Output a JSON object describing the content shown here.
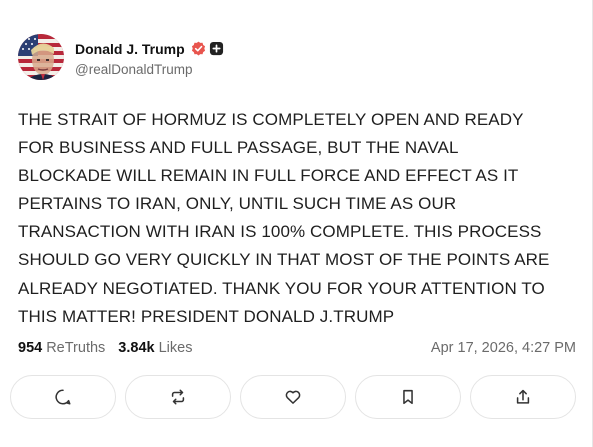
{
  "colors": {
    "verified_badge": "#e8554e",
    "follow_badge": "#222222",
    "muted_text": "#6b6b6b",
    "button_border": "#e4e4e4"
  },
  "author": {
    "display_name": "Donald J. Trump",
    "handle": "@realDonaldTrump",
    "avatar": "avatar-american-flag-portrait",
    "verified_icon": "verified-badge-icon",
    "follow_icon": "follow-plus-icon"
  },
  "post": {
    "lines": [
      "THE STRAIT OF HORMUZ IS COMPLETELY OPEN AND READY",
      "FOR BUSINESS AND FULL PASSAGE, BUT THE NAVAL",
      "BLOCKADE WILL REMAIN IN FULL FORCE AND EFFECT AS IT",
      "PERTAINS TO IRAN, ONLY, UNTIL SUCH TIME AS OUR",
      "TRANSACTION WITH IRAN IS 100% COMPLETE. THIS PROCESS",
      "SHOULD GO VERY QUICKLY IN THAT MOST OF THE POINTS ARE",
      "ALREADY NEGOTIATED. THANK YOU FOR YOUR ATTENTION TO",
      "THIS MATTER! PRESIDENT DONALD J.TRUMP"
    ]
  },
  "stats": {
    "retruths_count": "954",
    "retruths_label": "ReTruths",
    "likes_count": "3.84k",
    "likes_label": "Likes",
    "timestamp": "Apr 17, 2026, 4:27 PM"
  },
  "actions": [
    {
      "icon": "reply-icon"
    },
    {
      "icon": "retruth-icon"
    },
    {
      "icon": "like-icon"
    },
    {
      "icon": "bookmark-icon"
    },
    {
      "icon": "share-icon"
    }
  ]
}
